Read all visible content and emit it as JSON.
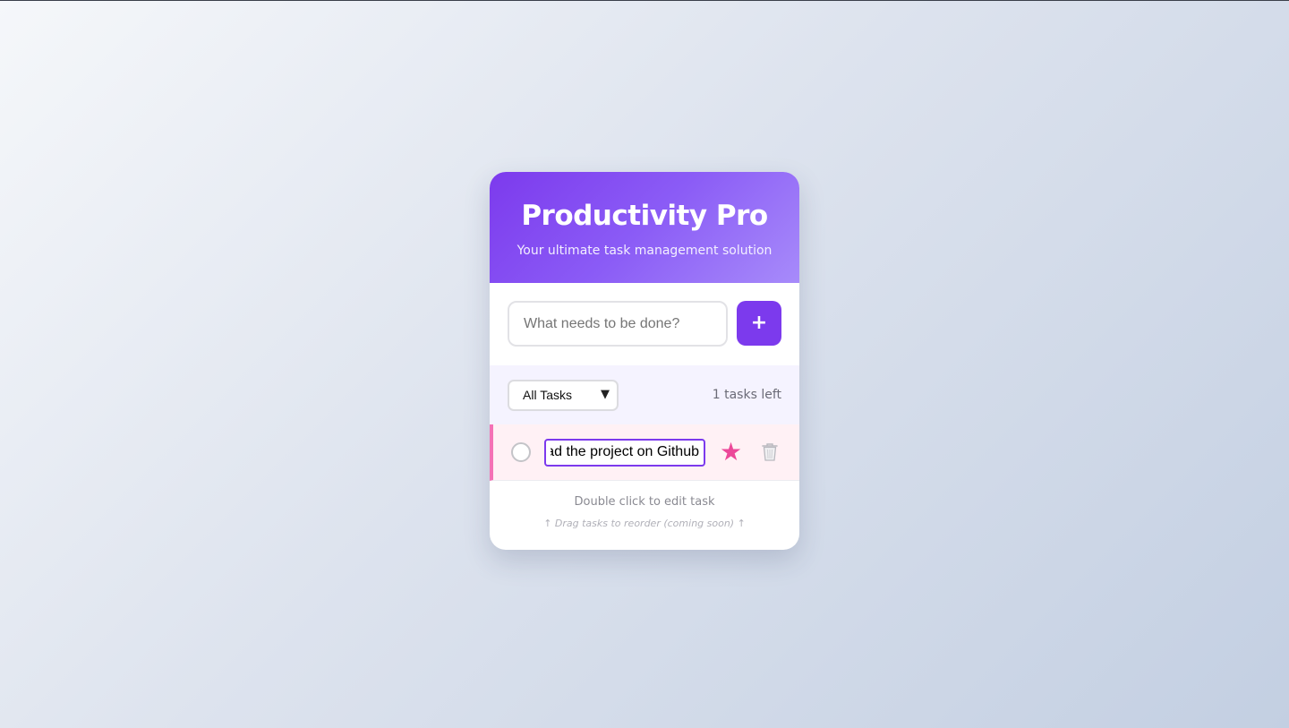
{
  "app": {
    "title": "Productivity Pro",
    "subtitle": "Your ultimate task management solution"
  },
  "add_task": {
    "placeholder": "What needs to be done?",
    "button_label": "+"
  },
  "filter": {
    "selected": "All Tasks",
    "chevron": "▼"
  },
  "tasks_left": "1 tasks left",
  "tasks": [
    {
      "edit_value": "Upload the project on Github",
      "visible_text": "ad the project on Github",
      "completed": false,
      "starred": true,
      "star_icon": "★"
    }
  ],
  "footer": {
    "hint": "Double click to edit task",
    "note": "↑ Drag tasks to reorder (coming soon) ↑"
  },
  "colors": {
    "accent": "#7c3aed",
    "star": "#ec4899",
    "task_row_bg": "#fff1f5",
    "task_row_border": "#f472b6"
  }
}
